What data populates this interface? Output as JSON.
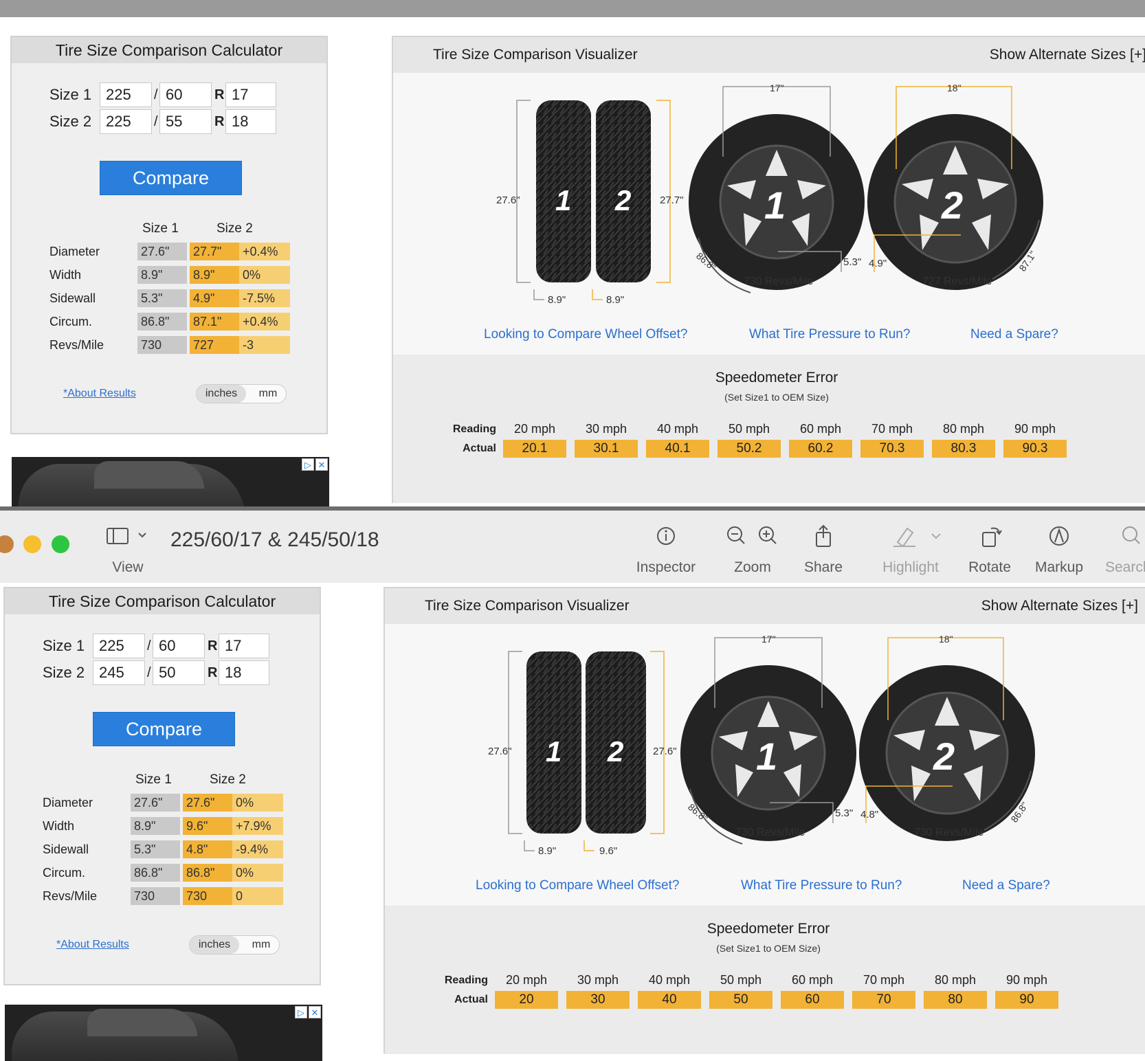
{
  "toolbar": {
    "title": "225/60/17 & 245/50/18",
    "view": "View",
    "inspector": "Inspector",
    "zoom": "Zoom",
    "share": "Share",
    "highlight": "Highlight",
    "rotate": "Rotate",
    "markup": "Markup",
    "search": "Search"
  },
  "calc_title": "Tire Size Comparison Calculator",
  "viz_title": "Tire Size Comparison Visualizer",
  "viz_alt": "Show Alternate Sizes [+]",
  "size1_label": "Size 1",
  "size2_label": "Size 2",
  "slash": "/",
  "r_label": "R",
  "compare_label": "Compare",
  "res_head1": "Size 1",
  "res_head2": "Size 2",
  "row_labels": [
    "Diameter",
    "Width",
    "Sidewall",
    "Circum.",
    "Revs/Mile"
  ],
  "about_label": "*About Results",
  "unit_inches": "inches",
  "unit_mm": "mm",
  "links": [
    "Looking to Compare Wheel Offset?",
    "What Tire Pressure to Run?",
    "Need a Spare?"
  ],
  "speedo_title": "Speedometer Error",
  "speedo_sub": "(Set Size1 to OEM Size)",
  "reading_label": "Reading",
  "actual_label": "Actual",
  "readings": [
    "20 mph",
    "30 mph",
    "40 mph",
    "50 mph",
    "60 mph",
    "70 mph",
    "80 mph",
    "90 mph"
  ],
  "tire_num1": "1",
  "tire_num2": "2",
  "top": {
    "size1": [
      "225",
      "60",
      "17"
    ],
    "size2": [
      "225",
      "55",
      "18"
    ],
    "rows": [
      [
        "27.6\"",
        "27.7\"",
        "+0.4%"
      ],
      [
        "8.9\"",
        "8.9\"",
        "0%"
      ],
      [
        "5.3\"",
        "4.9\"",
        "-7.5%"
      ],
      [
        "86.8\"",
        "87.1\"",
        "+0.4%"
      ],
      [
        "730",
        "727",
        "-3"
      ]
    ],
    "viz": {
      "h1": "27.6\"",
      "h2": "27.7\"",
      "w1": "8.9\"",
      "w2": "8.9\"",
      "rim1": "17\"",
      "rim2": "18\"",
      "side1": "5.3\"",
      "side2": "4.9\"",
      "circ1": "86.8\"",
      "circ2": "87.1\"",
      "revs1": "730 Revs/Mile",
      "revs2": "727 Revs/Mile"
    },
    "actual": [
      "20.1",
      "30.1",
      "40.1",
      "50.2",
      "60.2",
      "70.3",
      "80.3",
      "90.3"
    ]
  },
  "bottom": {
    "size1": [
      "225",
      "60",
      "17"
    ],
    "size2": [
      "245",
      "50",
      "18"
    ],
    "rows": [
      [
        "27.6\"",
        "27.6\"",
        "0%"
      ],
      [
        "8.9\"",
        "9.6\"",
        "+7.9%"
      ],
      [
        "5.3\"",
        "4.8\"",
        "-9.4%"
      ],
      [
        "86.8\"",
        "86.8\"",
        "0%"
      ],
      [
        "730",
        "730",
        "0"
      ]
    ],
    "viz": {
      "h1": "27.6\"",
      "h2": "27.6\"",
      "w1": "8.9\"",
      "w2": "9.6\"",
      "rim1": "17\"",
      "rim2": "18\"",
      "side1": "5.3\"",
      "side2": "4.8\"",
      "circ1": "86.8\"",
      "circ2": "86.8\"",
      "revs1": "730 Revs/Mile",
      "revs2": "730 Revs/Mile"
    },
    "actual": [
      "20",
      "30",
      "40",
      "50",
      "60",
      "70",
      "80",
      "90"
    ]
  },
  "colors": {
    "accent": "#2a7fdc",
    "size2_fill": "#f2b235",
    "diff_fill": "#f7cf73",
    "size1_fill": "#c9c9c9"
  }
}
